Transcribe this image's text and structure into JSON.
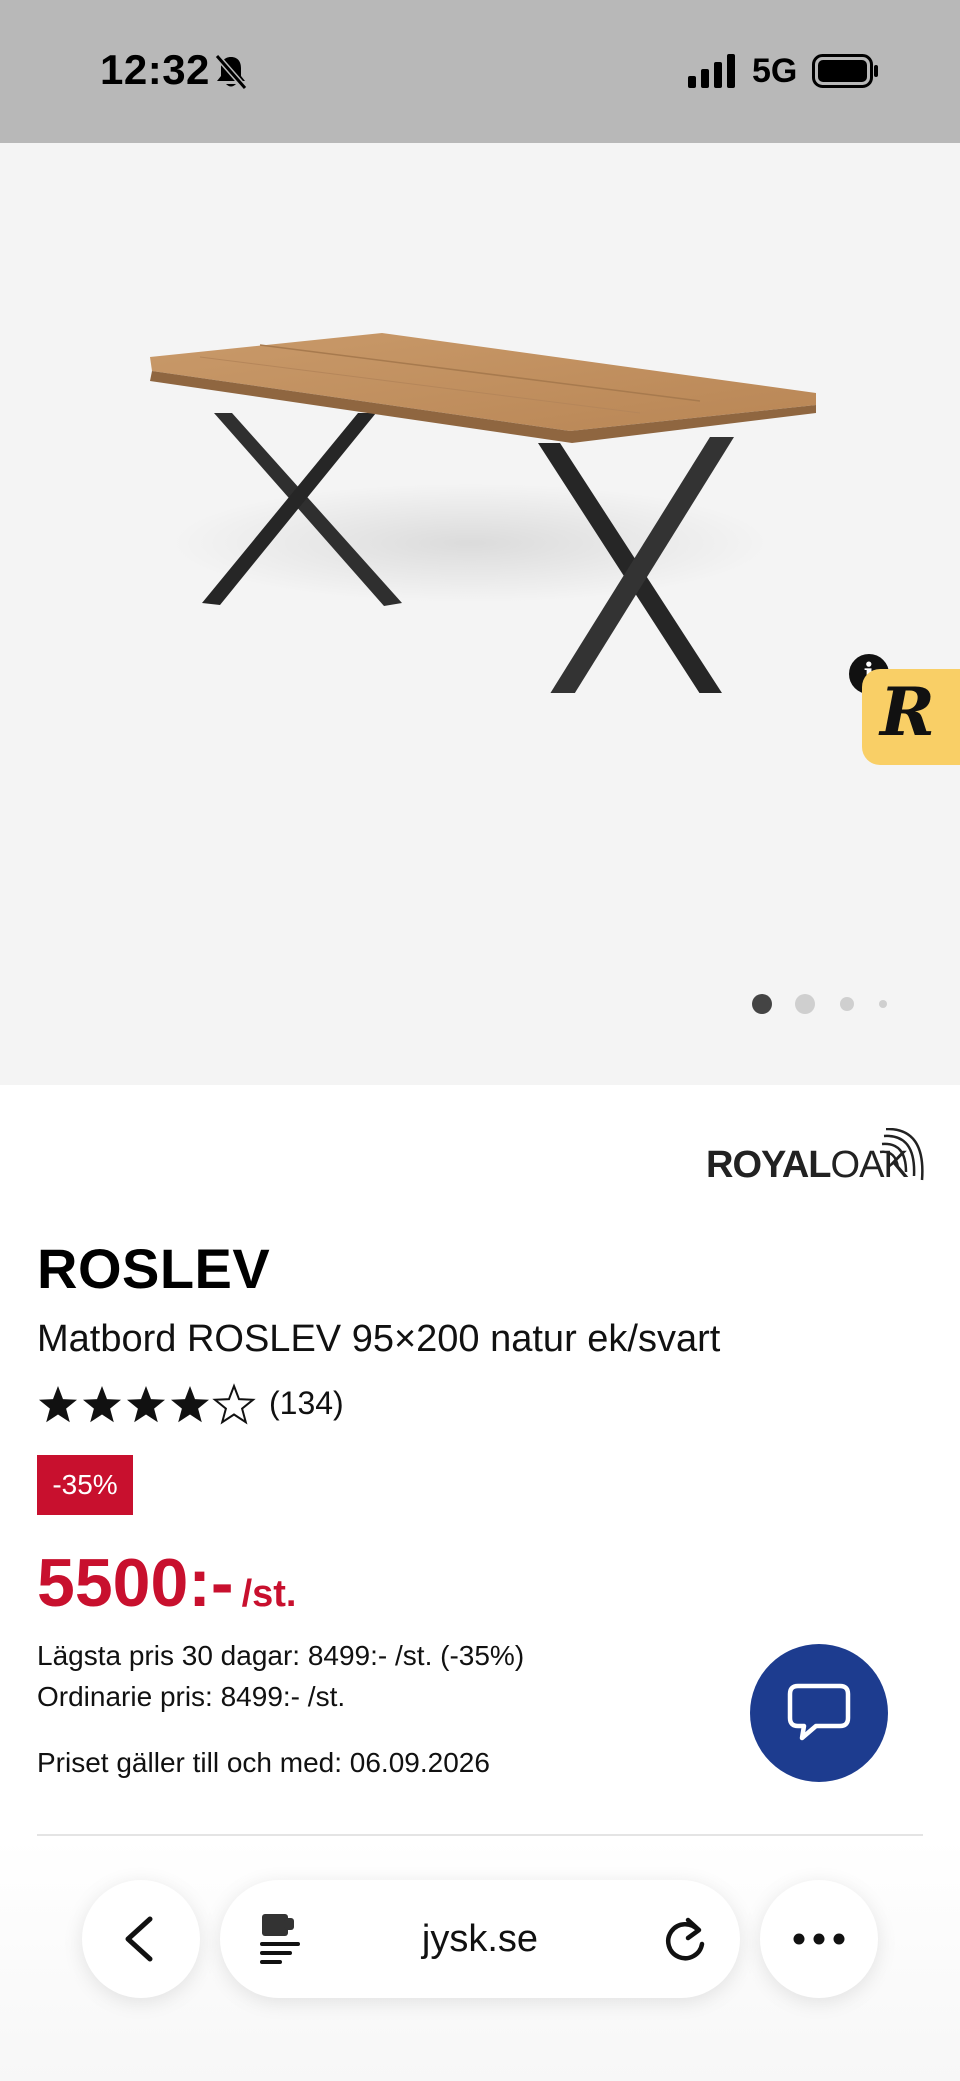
{
  "status_bar": {
    "time": "12:32",
    "network": "5G",
    "icons": [
      "bell-slash-icon",
      "signal-icon",
      "battery-icon"
    ]
  },
  "gallery": {
    "image": "oak-dining-table-with-black-x-legs",
    "badge_letter": "R",
    "info_label": "i",
    "slide_count": 4,
    "active_slide": 1
  },
  "brand": {
    "logo_part1": "ROYAL",
    "logo_part2": "OAK"
  },
  "product": {
    "name": "ROSLEV",
    "description": "Matbord ROSLEV 95×200 natur ek/svart",
    "rating_stars": 4,
    "rating_max": 5,
    "review_count": "(134)",
    "discount": "-35%",
    "price": "5500:-",
    "price_unit": "/st.",
    "lowest_price": "Lägsta pris 30 dagar: 8499:- /st. (-35%)",
    "ordinary_price": "Ordinarie pris: 8499:- /st.",
    "valid_until": "Priset gäller till och med: 06.09.2026"
  },
  "browser": {
    "url": "jysk.se"
  },
  "colors": {
    "accent_red": "#c8102e",
    "chat_blue": "#1d3c8f",
    "badge_yellow": "#f9cf66",
    "status_bar_gray": "#b8b8b8"
  }
}
